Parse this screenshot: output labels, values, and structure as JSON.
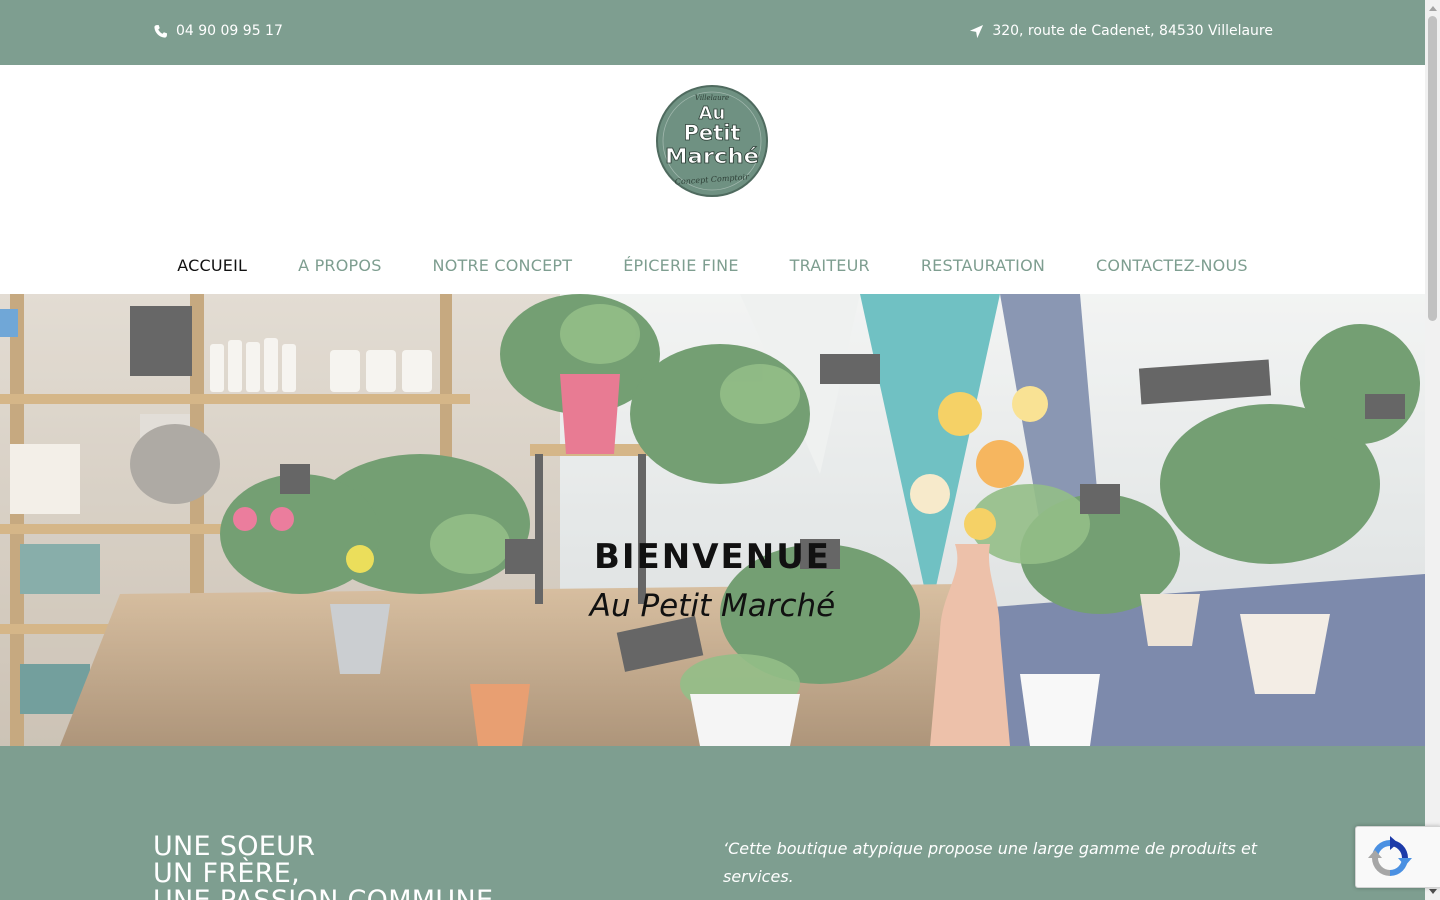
{
  "topbar": {
    "phone": "04 90 09 95 17",
    "address": "320, route de Cadenet, 84530 Villelaure",
    "phone_icon": "phone-icon",
    "location_icon": "location-arrow-icon"
  },
  "logo": {
    "line_top": "Villelaure",
    "line_au": "Au",
    "line_petit": "Petit",
    "line_marche": "Marché",
    "line_bottom": "Concept Comptoir"
  },
  "nav": {
    "items": [
      "ACCUEIL",
      "A PROPOS",
      "NOTRE CONCEPT",
      "ÉPICERIE FINE",
      "TRAITEUR",
      "RESTAURATION",
      "CONTACTEZ-NOUS"
    ],
    "active": "ACCUEIL"
  },
  "hero": {
    "title": "BIENVENUE",
    "subtitle": "Au Petit Marché"
  },
  "intro": {
    "heading_lines": [
      "UNE SOEUR",
      "UN FRÈRE,",
      "UNE PASSION COMMUNE"
    ],
    "quote_line1": "‘Cette boutique atypique propose une large gamme de produits et",
    "quote_line2": "services."
  },
  "colors": {
    "brand_green": "#7e9e90",
    "nav_active": "#111111",
    "white": "#ffffff"
  },
  "recaptcha": {
    "icon": "recaptcha-icon"
  }
}
